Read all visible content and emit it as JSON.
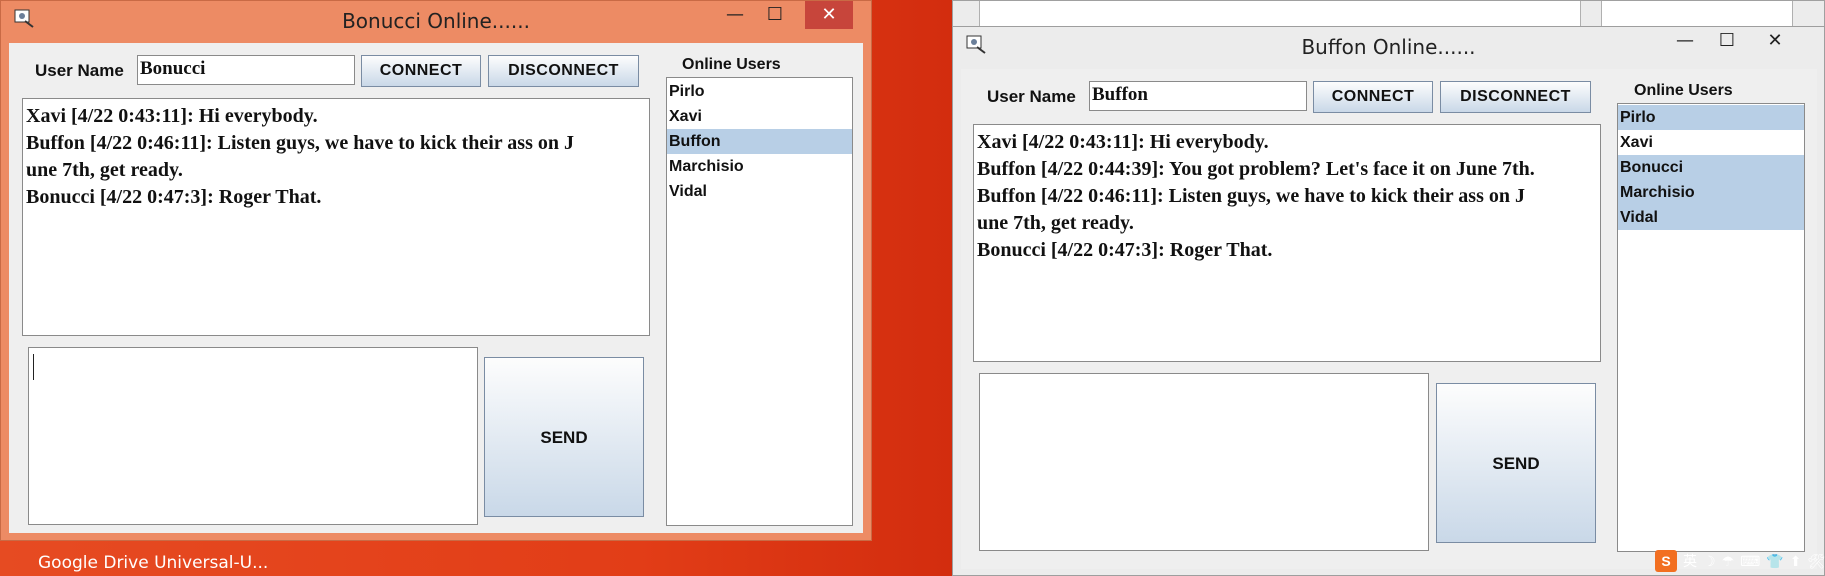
{
  "windows": [
    {
      "title": "Bonucci  Online......",
      "title_buttons": {
        "minimize": "—",
        "maximize": "☐",
        "close": "✕"
      },
      "user_name_label": "User Name",
      "user_name_value": "Bonucci",
      "connect_label": "CONNECT",
      "disconnect_label": "DISCONNECT",
      "online_users_label": "Online Users",
      "messages": [
        "Xavi [4/22 0:43:11]: Hi everybody.",
        "Buffon [4/22 0:46:11]: Listen guys, we have to kick their ass on J\nune 7th, get ready.",
        "Bonucci [4/22 0:47:3]: Roger That."
      ],
      "users": [
        "Pirlo",
        "Xavi",
        "Buffon",
        "Marchisio",
        "Vidal"
      ],
      "selected_users": [
        "Buffon"
      ],
      "send_label": "SEND"
    },
    {
      "title": "Buffon  Online......",
      "title_buttons": {
        "minimize": "—",
        "maximize": "☐",
        "close": "✕"
      },
      "user_name_label": "User Name",
      "user_name_value": "Buffon",
      "connect_label": "CONNECT",
      "disconnect_label": "DISCONNECT",
      "online_users_label": "Online Users",
      "messages": [
        "Xavi [4/22 0:43:11]: Hi everybody.",
        "Buffon [4/22 0:44:39]: You got problem? Let's face it on June 7th.",
        "Buffon [4/22 0:46:11]: Listen guys, we have to kick their ass on J\nune 7th, get ready.",
        "Bonucci [4/22 0:47:3]: Roger That."
      ],
      "users": [
        "Pirlo",
        "Xavi",
        "Bonucci",
        "Marchisio",
        "Vidal"
      ],
      "selected_users": [
        "Pirlo",
        "Bonucci",
        "Marchisio",
        "Vidal"
      ],
      "send_label": "SEND"
    }
  ],
  "taskbar": {
    "items_text": "Google Drive  Universal-U...",
    "tray_logo": "S",
    "tray_icons": [
      "英",
      "☽",
      "☂",
      "⌨",
      "👕",
      "⬆",
      "🛠"
    ]
  },
  "colors": {
    "win1_frame": "#ed8b64",
    "win2_frame": "#ececec",
    "close_button": "#c7453b",
    "selection": "#b8cfe6",
    "desktop": "#e23d17"
  },
  "icons": {
    "app": "app-icon",
    "minimize": "minimize-icon",
    "maximize": "maximize-icon",
    "close": "close-icon"
  }
}
